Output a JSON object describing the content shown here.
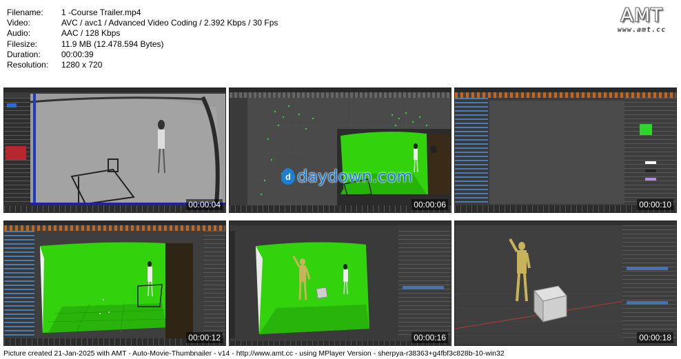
{
  "info": {
    "filename_label": "Filename:",
    "filename": "1 -Course Trailer.mp4",
    "video_label": "Video:",
    "video": "AVC / avc1 / Advanced Video Coding / 2.392 Kbps / 30 Fps",
    "audio_label": "Audio:",
    "audio": "AAC / 128 Kbps",
    "filesize_label": "Filesize:",
    "filesize": "11.9 MB (12.478.594 Bytes)",
    "duration_label": "Duration:",
    "duration": "00:00:39",
    "resolution_label": "Resolution:",
    "resolution": "1280 x 720"
  },
  "brand": {
    "logo": "AMT",
    "url": "www.amt.cc"
  },
  "watermark": {
    "text": "daydown.com",
    "glyph": "d"
  },
  "thumbnails": [
    {
      "timestamp": "00:00:04"
    },
    {
      "timestamp": "00:00:06"
    },
    {
      "timestamp": "00:00:10"
    },
    {
      "timestamp": "00:00:12"
    },
    {
      "timestamp": "00:00:16"
    },
    {
      "timestamp": "00:00:18"
    }
  ],
  "footer": "Picture created 21-Jan-2025 with AMT - Auto-Movie-Thumbnailer - v14 - http://www.amt.cc - using MPlayer Version - sherpya-r38363+g4fbf3c828b-10-win32",
  "colors": {
    "greenscreen": "#32d30c",
    "figure": "#c9b35a",
    "timestamp_bg": "#000000"
  }
}
